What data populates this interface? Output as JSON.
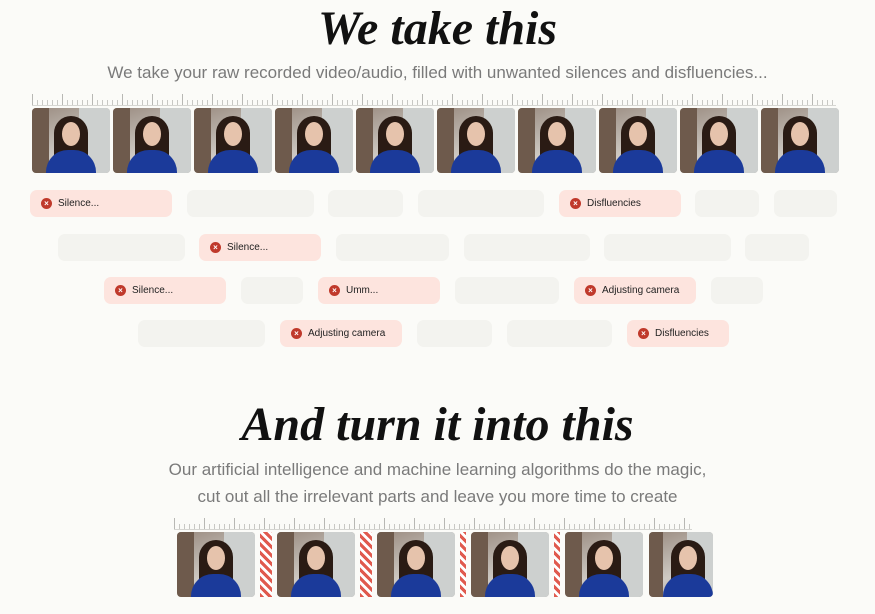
{
  "section_before": {
    "title": "We take this",
    "subtitle": "We take your raw recorded video/audio, filled with unwanted silences and disfluencies..."
  },
  "tags": {
    "silence": "Silence...",
    "disfluencies": "Disfluencies",
    "umm": "Umm...",
    "adjusting_camera": "Adjusting camera"
  },
  "section_after": {
    "title": "And turn it into this",
    "subtitle_line1": "Our artificial intelligence and machine learning algorithms do the magic,",
    "subtitle_line2": "cut out all the irrelevant parts and leave you more time to create"
  },
  "colors": {
    "background": "#fbfbf8",
    "flag_chip": "#fde4de",
    "flag_icon": "#c0392b",
    "placeholder_chip": "#f3f3ef",
    "cut_marker": "#e05a4e"
  },
  "icons": {
    "flag": "close-circle-icon"
  }
}
